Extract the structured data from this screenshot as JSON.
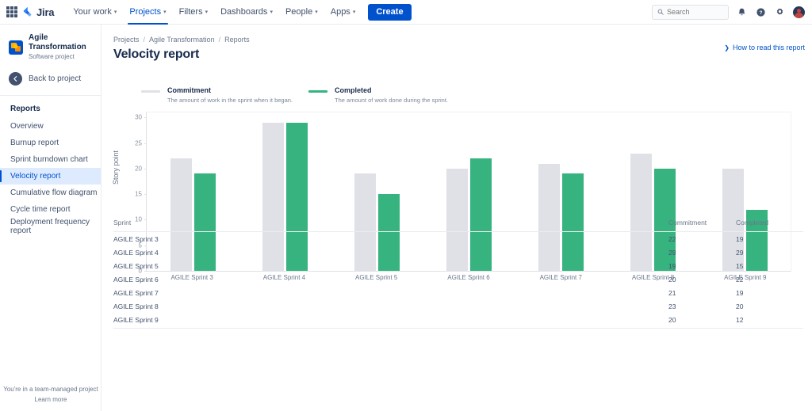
{
  "topnav": {
    "apps_icon": "apps-grid-icon",
    "logo_text": "Jira",
    "items": [
      {
        "label": "Your work",
        "caret": "▾"
      },
      {
        "label": "Projects",
        "caret": "▾"
      },
      {
        "label": "Filters",
        "caret": "▾"
      },
      {
        "label": "Dashboards",
        "caret": "▾"
      },
      {
        "label": "People",
        "caret": "▾"
      },
      {
        "label": "Apps",
        "caret": "▾"
      }
    ],
    "create_label": "Create",
    "search_placeholder": "Search",
    "search_value": "",
    "icons": [
      "notification-bell-icon",
      "help-icon",
      "settings-gear-icon",
      "user-avatar"
    ]
  },
  "sidebar": {
    "project_name": "Agile Transformation",
    "project_type": "Software project",
    "back_label": "Back to project",
    "section_heading": "Reports",
    "items": [
      {
        "label": "Overview"
      },
      {
        "label": "Burnup report"
      },
      {
        "label": "Sprint burndown chart"
      },
      {
        "label": "Velocity report"
      },
      {
        "label": "Cumulative flow diagram"
      },
      {
        "label": "Cycle time report"
      },
      {
        "label": "Deployment frequency report"
      }
    ],
    "footer_text": "You're in a team-managed project",
    "footer_link": "Learn more"
  },
  "main": {
    "breadcrumb": [
      "Projects",
      "Agile Transformation",
      "Reports"
    ],
    "breadcrumb_sep": "/",
    "page_title": "Velocity report",
    "how_to_read": "How to read this report",
    "how_to_read_chevron": "❯"
  },
  "legend": [
    {
      "title": "Commitment",
      "description": "The amount of work in the sprint when it began.",
      "color": "#DFE1E6"
    },
    {
      "title": "Completed",
      "description": "The amount of work done during the sprint.",
      "color": "#36B37E"
    }
  ],
  "chart_data": {
    "type": "bar",
    "title": "",
    "xlabel": "",
    "ylabel": "Story point",
    "ylim": [
      0,
      31
    ],
    "yticks": [
      0,
      5,
      10,
      15,
      20,
      25,
      30
    ],
    "grid": false,
    "legend_position": "above-chart",
    "categories": [
      "AGILE Sprint 3",
      "AGILE Sprint 4",
      "AGILE Sprint 5",
      "AGILE Sprint 6",
      "AGILE Sprint 7",
      "AGILE Sprint 8",
      "AGILE Sprint 9"
    ],
    "series": [
      {
        "name": "Commitment",
        "color": "#DFE1E6",
        "values": [
          22,
          29,
          19,
          20,
          21,
          23,
          20
        ]
      },
      {
        "name": "Completed",
        "color": "#36B37E",
        "values": [
          19,
          29,
          15,
          22,
          19,
          20,
          12
        ]
      }
    ]
  },
  "table": {
    "headers": [
      "Sprint",
      "Commitment",
      "Completed"
    ],
    "rows": [
      [
        "AGILE Sprint 3",
        "22",
        "19"
      ],
      [
        "AGILE Sprint 4",
        "29",
        "29"
      ],
      [
        "AGILE Sprint 5",
        "19",
        "15"
      ],
      [
        "AGILE Sprint 6",
        "20",
        "22"
      ],
      [
        "AGILE Sprint 7",
        "21",
        "19"
      ],
      [
        "AGILE Sprint 8",
        "23",
        "20"
      ],
      [
        "AGILE Sprint 9",
        "20",
        "12"
      ]
    ]
  }
}
